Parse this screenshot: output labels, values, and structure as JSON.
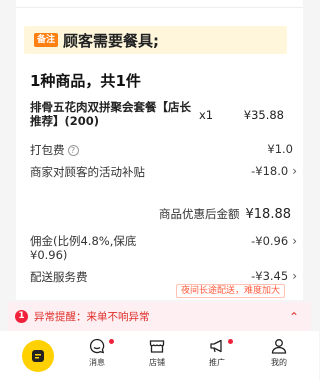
{
  "note": {
    "tag": "备注",
    "text": "顾客需要餐具;"
  },
  "items_header": "1种商品，共1件",
  "items": [
    {
      "name": "排骨五花肉双拼聚会套餐【店长推荐】(200)",
      "qty": "x1",
      "price": "¥35.88"
    }
  ],
  "rows": {
    "packing": {
      "label": "打包费",
      "value": "¥1.0"
    },
    "subsidy": {
      "label": "商家对顾客的活动补贴",
      "value": "-¥18.0"
    },
    "subtotal": {
      "label": "商品优惠后金额",
      "value": "¥18.88"
    },
    "commission": {
      "label": "佣金(比例4.8%,保底¥0.96)",
      "value": "-¥0.96"
    },
    "delivery": {
      "label": "配送服务费",
      "value": "-¥3.45"
    },
    "delivery_tip": "夜间长途配送，难度加大"
  },
  "alert": {
    "count": "1",
    "text": "异常提醒：来单不响异常"
  },
  "tabbar": {
    "tabs": [
      {
        "label": "消息",
        "has_dot": true
      },
      {
        "label": "店铺",
        "has_dot": false
      },
      {
        "label": "推广",
        "has_dot": true
      },
      {
        "label": "我的",
        "has_dot": false
      }
    ]
  },
  "colors": {
    "accent_yellow": "#ffd100",
    "alert_red": "#e0302c",
    "tag_orange": "#ff7f10"
  }
}
